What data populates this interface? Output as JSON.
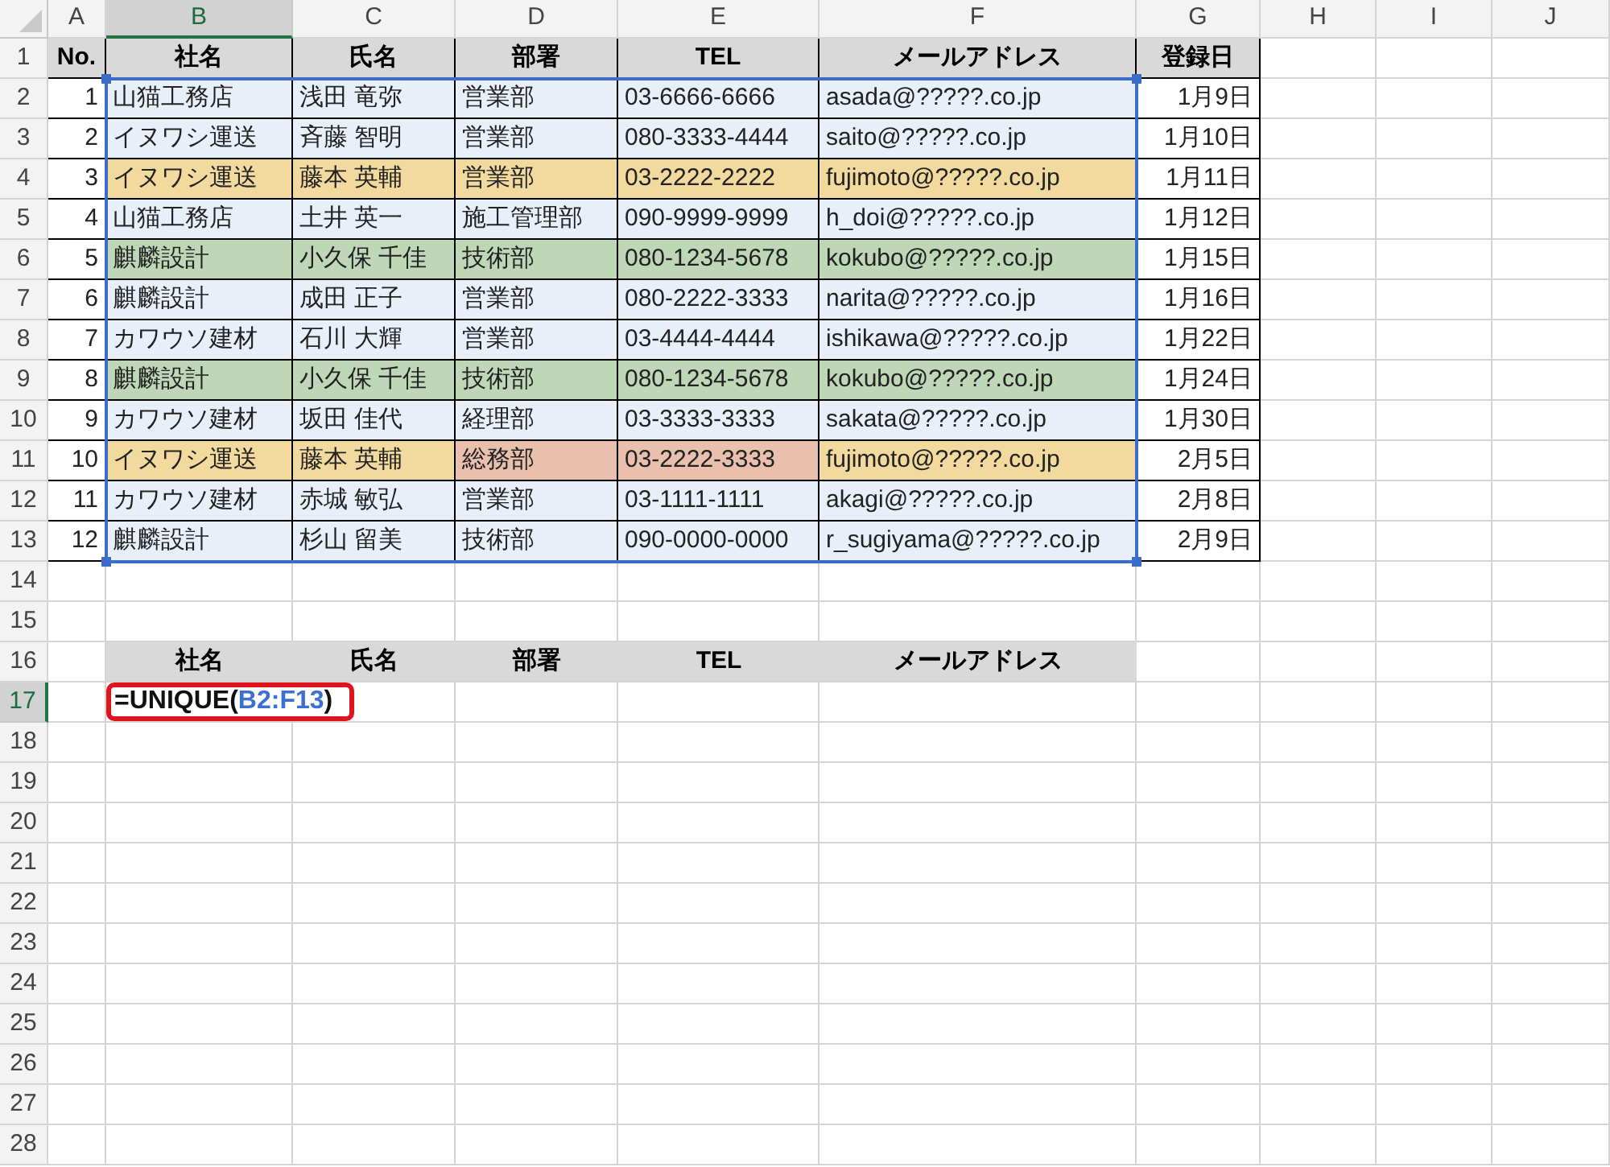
{
  "column_headers": [
    {
      "label": "A",
      "selected": false
    },
    {
      "label": "B",
      "selected": true
    },
    {
      "label": "C",
      "selected": false
    },
    {
      "label": "D",
      "selected": false
    },
    {
      "label": "E",
      "selected": false
    },
    {
      "label": "F",
      "selected": false
    },
    {
      "label": "G",
      "selected": false
    },
    {
      "label": "H",
      "selected": false
    },
    {
      "label": "I",
      "selected": false
    },
    {
      "label": "J",
      "selected": false
    }
  ],
  "row_headers": [
    {
      "label": "1",
      "selected": false
    },
    {
      "label": "2",
      "selected": false
    },
    {
      "label": "3",
      "selected": false
    },
    {
      "label": "4",
      "selected": false
    },
    {
      "label": "5",
      "selected": false
    },
    {
      "label": "6",
      "selected": false
    },
    {
      "label": "7",
      "selected": false
    },
    {
      "label": "8",
      "selected": false
    },
    {
      "label": "9",
      "selected": false
    },
    {
      "label": "10",
      "selected": false
    },
    {
      "label": "11",
      "selected": false
    },
    {
      "label": "12",
      "selected": false
    },
    {
      "label": "13",
      "selected": false
    },
    {
      "label": "14",
      "selected": false
    },
    {
      "label": "15",
      "selected": false
    },
    {
      "label": "16",
      "selected": false
    },
    {
      "label": "17",
      "selected": true
    },
    {
      "label": "18",
      "selected": false
    },
    {
      "label": "19",
      "selected": false
    },
    {
      "label": "20",
      "selected": false
    },
    {
      "label": "21",
      "selected": false
    },
    {
      "label": "22",
      "selected": false
    },
    {
      "label": "23",
      "selected": false
    },
    {
      "label": "24",
      "selected": false
    },
    {
      "label": "25",
      "selected": false
    },
    {
      "label": "26",
      "selected": false
    },
    {
      "label": "27",
      "selected": false
    },
    {
      "label": "28",
      "selected": false
    }
  ],
  "table": {
    "columns": [
      "No.",
      "社名",
      "氏名",
      "部署",
      "TEL",
      "メールアドレス",
      "登録日"
    ],
    "rows": [
      {
        "cells": [
          {
            "text": "1"
          },
          {
            "text": "山猫工務店",
            "color": "#e9eff8"
          },
          {
            "text": "浅田 竜弥",
            "color": "#e9eff8"
          },
          {
            "text": "営業部",
            "color": "#e9eff8"
          },
          {
            "text": "03-6666-6666",
            "color": "#e9eff8"
          },
          {
            "text": "asada@?????.co.jp",
            "color": "#e9eff8"
          },
          {
            "text": "1月9日"
          }
        ]
      },
      {
        "cells": [
          {
            "text": "2"
          },
          {
            "text": "イヌワシ運送",
            "color": "#e9eff8"
          },
          {
            "text": "斉藤 智明",
            "color": "#e9eff8"
          },
          {
            "text": "営業部",
            "color": "#e9eff8"
          },
          {
            "text": "080-3333-4444",
            "color": "#e9eff8"
          },
          {
            "text": "saito@?????.co.jp",
            "color": "#e9eff8"
          },
          {
            "text": "1月10日"
          }
        ]
      },
      {
        "cells": [
          {
            "text": "3"
          },
          {
            "text": "イヌワシ運送",
            "color": "#f2d99e"
          },
          {
            "text": "藤本 英輔",
            "color": "#f2d99e"
          },
          {
            "text": "営業部",
            "color": "#f2d99e"
          },
          {
            "text": "03-2222-2222",
            "color": "#f2d99e"
          },
          {
            "text": "fujimoto@?????.co.jp",
            "color": "#f2d99e"
          },
          {
            "text": "1月11日"
          }
        ]
      },
      {
        "cells": [
          {
            "text": "4"
          },
          {
            "text": "山猫工務店",
            "color": "#e9eff8"
          },
          {
            "text": "土井 英一",
            "color": "#e9eff8"
          },
          {
            "text": "施工管理部",
            "color": "#e9eff8"
          },
          {
            "text": "090-9999-9999",
            "color": "#e9eff8"
          },
          {
            "text": "h_doi@?????.co.jp",
            "color": "#e9eff8"
          },
          {
            "text": "1月12日"
          }
        ]
      },
      {
        "cells": [
          {
            "text": "5"
          },
          {
            "text": "麒麟設計",
            "color": "#bed7b7"
          },
          {
            "text": "小久保 千佳",
            "color": "#bed7b7"
          },
          {
            "text": "技術部",
            "color": "#bed7b7"
          },
          {
            "text": "080-1234-5678",
            "color": "#bed7b7"
          },
          {
            "text": "kokubo@?????.co.jp",
            "color": "#bed7b7"
          },
          {
            "text": "1月15日"
          }
        ]
      },
      {
        "cells": [
          {
            "text": "6"
          },
          {
            "text": "麒麟設計",
            "color": "#e9eff8"
          },
          {
            "text": "成田 正子",
            "color": "#e9eff8"
          },
          {
            "text": "営業部",
            "color": "#e9eff8"
          },
          {
            "text": "080-2222-3333",
            "color": "#e9eff8"
          },
          {
            "text": "narita@?????.co.jp",
            "color": "#e9eff8"
          },
          {
            "text": "1月16日"
          }
        ]
      },
      {
        "cells": [
          {
            "text": "7"
          },
          {
            "text": "カワウソ建材",
            "color": "#e9eff8"
          },
          {
            "text": "石川 大輝",
            "color": "#e9eff8"
          },
          {
            "text": "営業部",
            "color": "#e9eff8"
          },
          {
            "text": "03-4444-4444",
            "color": "#e9eff8"
          },
          {
            "text": "ishikawa@?????.co.jp",
            "color": "#e9eff8"
          },
          {
            "text": "1月22日"
          }
        ]
      },
      {
        "cells": [
          {
            "text": "8"
          },
          {
            "text": "麒麟設計",
            "color": "#bed7b7"
          },
          {
            "text": "小久保 千佳",
            "color": "#bed7b7"
          },
          {
            "text": "技術部",
            "color": "#bed7b7"
          },
          {
            "text": "080-1234-5678",
            "color": "#bed7b7"
          },
          {
            "text": "kokubo@?????.co.jp",
            "color": "#bed7b7"
          },
          {
            "text": "1月24日"
          }
        ]
      },
      {
        "cells": [
          {
            "text": "9"
          },
          {
            "text": "カワウソ建材",
            "color": "#e9eff8"
          },
          {
            "text": "坂田 佳代",
            "color": "#e9eff8"
          },
          {
            "text": "経理部",
            "color": "#e9eff8"
          },
          {
            "text": "03-3333-3333",
            "color": "#e9eff8"
          },
          {
            "text": "sakata@?????.co.jp",
            "color": "#e9eff8"
          },
          {
            "text": "1月30日"
          }
        ]
      },
      {
        "cells": [
          {
            "text": "10"
          },
          {
            "text": "イヌワシ運送",
            "color": "#f2d99e"
          },
          {
            "text": "藤本 英輔",
            "color": "#f2d99e"
          },
          {
            "text": "総務部",
            "color": "#e8c0ad"
          },
          {
            "text": "03-2222-3333",
            "color": "#e8c0ad"
          },
          {
            "text": "fujimoto@?????.co.jp",
            "color": "#f2d99e"
          },
          {
            "text": "2月5日"
          }
        ]
      },
      {
        "cells": [
          {
            "text": "11"
          },
          {
            "text": "カワウソ建材",
            "color": "#e9eff8"
          },
          {
            "text": "赤城 敏弘",
            "color": "#e9eff8"
          },
          {
            "text": "営業部",
            "color": "#e9eff8"
          },
          {
            "text": "03-1111-1111",
            "color": "#e9eff8"
          },
          {
            "text": "akagi@?????.co.jp",
            "color": "#e9eff8"
          },
          {
            "text": "2月8日"
          }
        ]
      },
      {
        "cells": [
          {
            "text": "12"
          },
          {
            "text": "麒麟設計",
            "color": "#e9eff8"
          },
          {
            "text": "杉山 留美",
            "color": "#e9eff8"
          },
          {
            "text": "技術部",
            "color": "#e9eff8"
          },
          {
            "text": "090-0000-0000",
            "color": "#e9eff8"
          },
          {
            "text": "r_sugiyama@?????.co.jp",
            "color": "#e9eff8"
          },
          {
            "text": "2月9日"
          }
        ]
      }
    ]
  },
  "output_header": [
    "社名",
    "氏名",
    "部署",
    "TEL",
    "メールアドレス"
  ],
  "formula_cell": {
    "parts": [
      {
        "kind": "function",
        "text": "=UNIQUE("
      },
      {
        "kind": "reference",
        "text": "B2:F13"
      },
      {
        "kind": "function",
        "text": ")"
      }
    ]
  }
}
